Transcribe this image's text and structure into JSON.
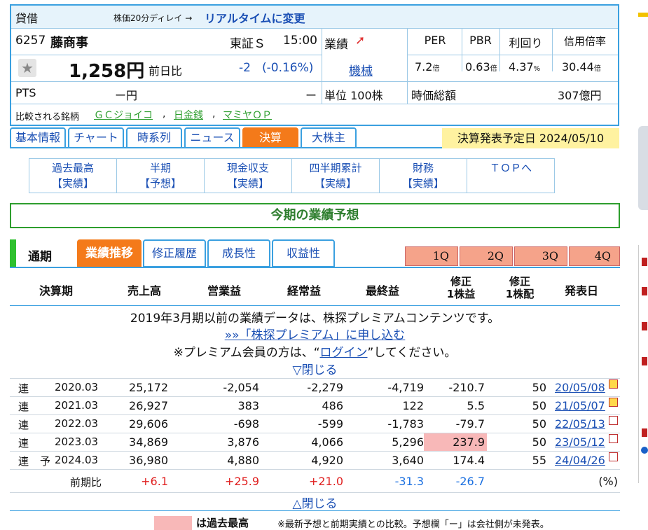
{
  "header": {
    "label_kashishaku": "貸借",
    "delay_note": "株価20分ディレイ →",
    "realtime_link": "リアルタイムに変更",
    "code": "6257",
    "name": "藤商事",
    "market": "東証Ｓ",
    "time": "15:00",
    "gyoseki_label": "業績",
    "sector_link": "機械",
    "star_icon": "star-icon",
    "price": "1,258円",
    "prev_label": "前日比",
    "change": "-2",
    "change_pct": "(-0.16%)",
    "pts_label": "PTS",
    "pts_value": "ー円",
    "pts_dash": "ー",
    "unit": "単位 100株",
    "metrics_headers": [
      "PER",
      "PBR",
      "利回り",
      "信用倍率"
    ],
    "metrics_values": [
      "7.2",
      "0.63",
      "4.37",
      "30.44"
    ],
    "metrics_units": [
      "倍",
      "倍",
      "%",
      "倍"
    ],
    "market_cap_label": "時価総額",
    "market_cap_value": "307億円",
    "compare_label": "比較される銘柄",
    "compare_links": [
      "ＧＣジョイコ",
      "日金銭",
      "マミヤＯＰ"
    ]
  },
  "tabs": [
    "基本情報",
    "チャート",
    "時系列",
    "ニュース",
    "決算",
    "大株主"
  ],
  "active_tab": "決算",
  "announce": "決算発表予定日 2024/05/10",
  "subnav": [
    {
      "l1": "過去最高",
      "l2": "【実績】"
    },
    {
      "l1": "半期",
      "l2": "【予想】"
    },
    {
      "l1": "現金収支",
      "l2": "【実績】"
    },
    {
      "l1": "四半期累計",
      "l2": "【実績】"
    },
    {
      "l1": "財務",
      "l2": "【実績】"
    },
    {
      "l1": "ＴＯＰへ",
      "l2": ""
    }
  ],
  "forecast_title": "今期の業績予想",
  "section": {
    "label": "通期",
    "tabs": [
      "業績推移",
      "修正履歴",
      "成長性",
      "収益性"
    ],
    "active": "業績推移",
    "quarters": [
      "1Q",
      "2Q",
      "3Q",
      "4Q"
    ]
  },
  "table": {
    "headers": [
      "決算期",
      "売上高",
      "営業益",
      "経常益",
      "最終益",
      "修正\n1株益",
      "修正\n1株配",
      "発表日"
    ],
    "premium_msg": "2019年3月期以前の業績データは、株探プレミアムコンテンツです。",
    "premium_link": "»»「株探プレミアム」に申し込む",
    "login_pre": "※プレミアム会員の方は、“",
    "login_link": "ログイン",
    "login_post": "”してください。",
    "close_top": "▽閉じる",
    "close_bottom": "△閉じる",
    "rows": [
      {
        "type": "連",
        "yo": "",
        "period": "2020.03",
        "sales": "25,172",
        "op": "-2,054",
        "ord": "-2,279",
        "net": "-4,719",
        "eps": "-210.7",
        "div": "50",
        "date": "20/05/08"
      },
      {
        "type": "連",
        "yo": "",
        "period": "2021.03",
        "sales": "26,927",
        "op": "383",
        "ord": "486",
        "net": "122",
        "eps": "5.5",
        "div": "50",
        "date": "21/05/07"
      },
      {
        "type": "連",
        "yo": "",
        "period": "2022.03",
        "sales": "29,606",
        "op": "-698",
        "ord": "-599",
        "net": "-1,783",
        "eps": "-79.7",
        "div": "50",
        "date": "22/05/13"
      },
      {
        "type": "連",
        "yo": "",
        "period": "2023.03",
        "sales": "34,869",
        "op": "3,876",
        "ord": "4,066",
        "net": "5,296",
        "eps": "237.9",
        "div": "50",
        "date": "23/05/12"
      },
      {
        "type": "連",
        "yo": "予",
        "period": "2024.03",
        "sales": "36,980",
        "op": "4,880",
        "ord": "4,920",
        "net": "3,640",
        "eps": "174.4",
        "div": "55",
        "date": "24/04/26"
      }
    ],
    "yoy_label": "前期比",
    "yoy": [
      "+6.1",
      "+25.9",
      "+21.0",
      "-31.3",
      "-26.7"
    ],
    "yoy_unit": "(%)",
    "footnote": "※最新予想と前期実績との比較。予想欄「ー」は会社側が未発表。",
    "legend_label": "は過去最高"
  },
  "colors": {
    "accent": "#3aa0e0",
    "orange": "#f47a1a",
    "green": "#2e9e2e",
    "highlight": "#f8b8b8",
    "yellow": "#fff2a0"
  }
}
